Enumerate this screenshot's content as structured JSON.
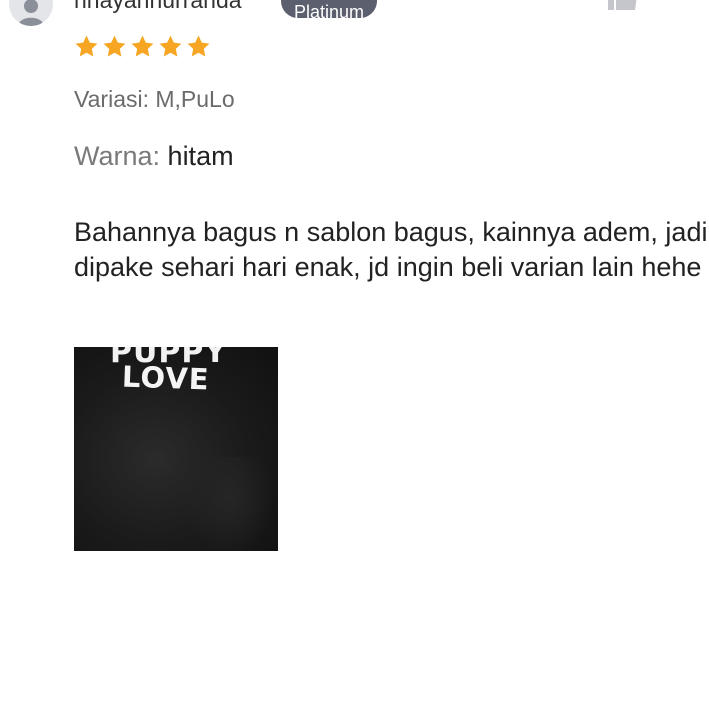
{
  "reviewer": {
    "username": "nnayannurranda",
    "badge": "Platinum",
    "avatar_icon": "person-icon"
  },
  "actions": {
    "like_icon": "thumbs-up-icon",
    "more_icon": "more-options-icon"
  },
  "rating": {
    "stars": 5,
    "max": 5,
    "star_color": "#f6a623"
  },
  "variant": {
    "text": "Variasi: M,PuLo"
  },
  "color_attr": {
    "key": "Warna:",
    "value": "hitam"
  },
  "review_text": "Bahannya bagus n sablon bagus, kainnya adem, jadi dipake sehari hari enak, jd ingin beli varian lain hehe",
  "photo": {
    "print_top": "PUPPY",
    "print_text": "LOVE"
  },
  "colors": {
    "badge_bg": "#5c5f6e",
    "text": "#222222",
    "muted": "#6b6b6b"
  }
}
